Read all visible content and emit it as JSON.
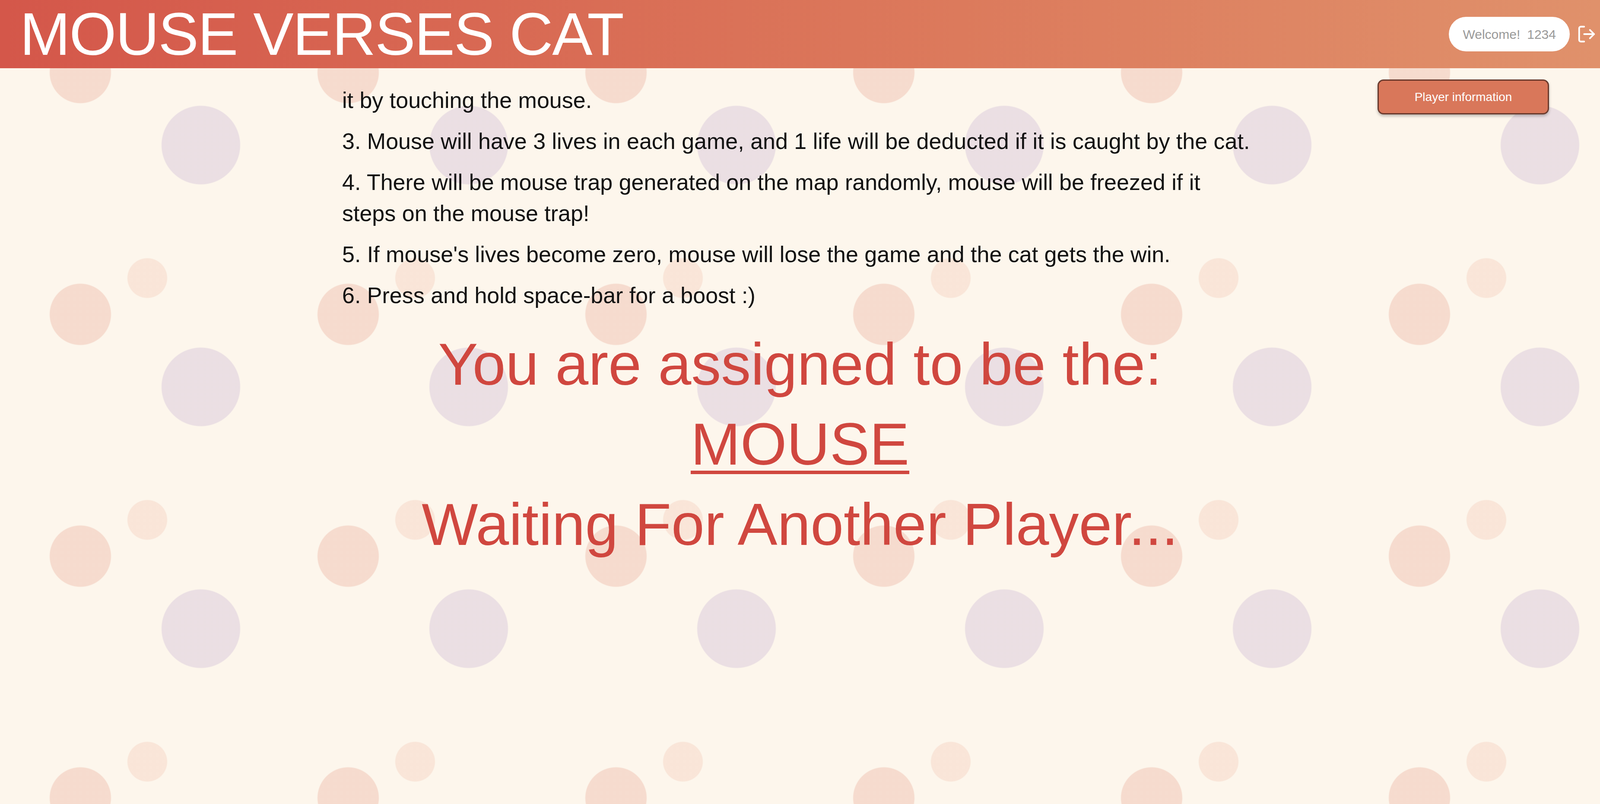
{
  "header": {
    "title": "MOUSE VERSES CAT",
    "welcome": "Welcome!",
    "user": "1234"
  },
  "player_info_button": "Player information",
  "rules": [
    "it by touching the mouse.",
    "3. Mouse will have 3 lives in each game, and 1 life will be deducted if it is caught by the cat.",
    "4. There will be mouse trap generated on the map randomly, mouse will be freezed if it steps on the mouse trap!",
    "5. If mouse's lives become zero, mouse will lose the game and the cat gets the win.",
    "6. Press and hold space-bar for a boost :)"
  ],
  "assignment": {
    "label": "You are assigned to be the:",
    "role": "MOUSE"
  },
  "status": "Waiting For Another Player..."
}
